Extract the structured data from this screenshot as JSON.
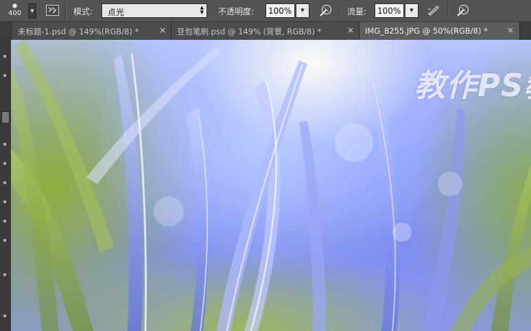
{
  "options_bar": {
    "brush_size": "400",
    "mode_label": "模式:",
    "mode_value": "点光",
    "opacity_label": "不透明度:",
    "opacity_value": "100%",
    "flow_label": "流量:",
    "flow_value": "100%"
  },
  "tabs": [
    {
      "title": "未标题-1.psd @ 149%(RGB/8) *",
      "close": "×"
    },
    {
      "title": "豆包笔刷.psd @ 149% (背景, RGB/8) *",
      "close": "×"
    },
    {
      "title": "IMG_8255.JPG @ 50%(RGB/8) *",
      "close": "×",
      "active": true
    }
  ],
  "canvas": {
    "watermark_text": "教作PS敎"
  },
  "icons": {
    "brush_panel": "brush-panel-icon",
    "airbrush": "airbrush-icon",
    "tablet_pressure": "tablet-pressure-icon"
  }
}
